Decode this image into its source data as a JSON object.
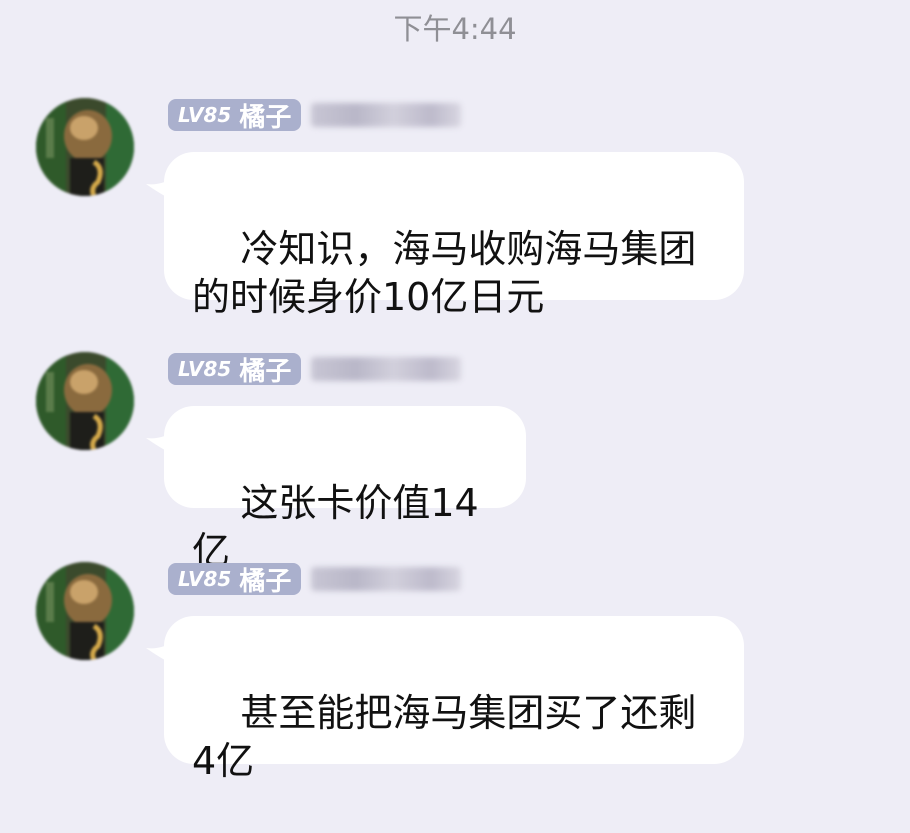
{
  "chat": {
    "timestamp": "下午4:44",
    "messages": [
      {
        "level": "LV85",
        "nickname": "橘子",
        "text": "冷知识，海马收购海马集团\n的时候身价10亿日元"
      },
      {
        "level": "LV85",
        "nickname": "橘子",
        "text": "这张卡价值14亿"
      },
      {
        "level": "LV85",
        "nickname": "橘子",
        "text": "甚至能把海马集团买了还剩\n4亿"
      }
    ]
  }
}
